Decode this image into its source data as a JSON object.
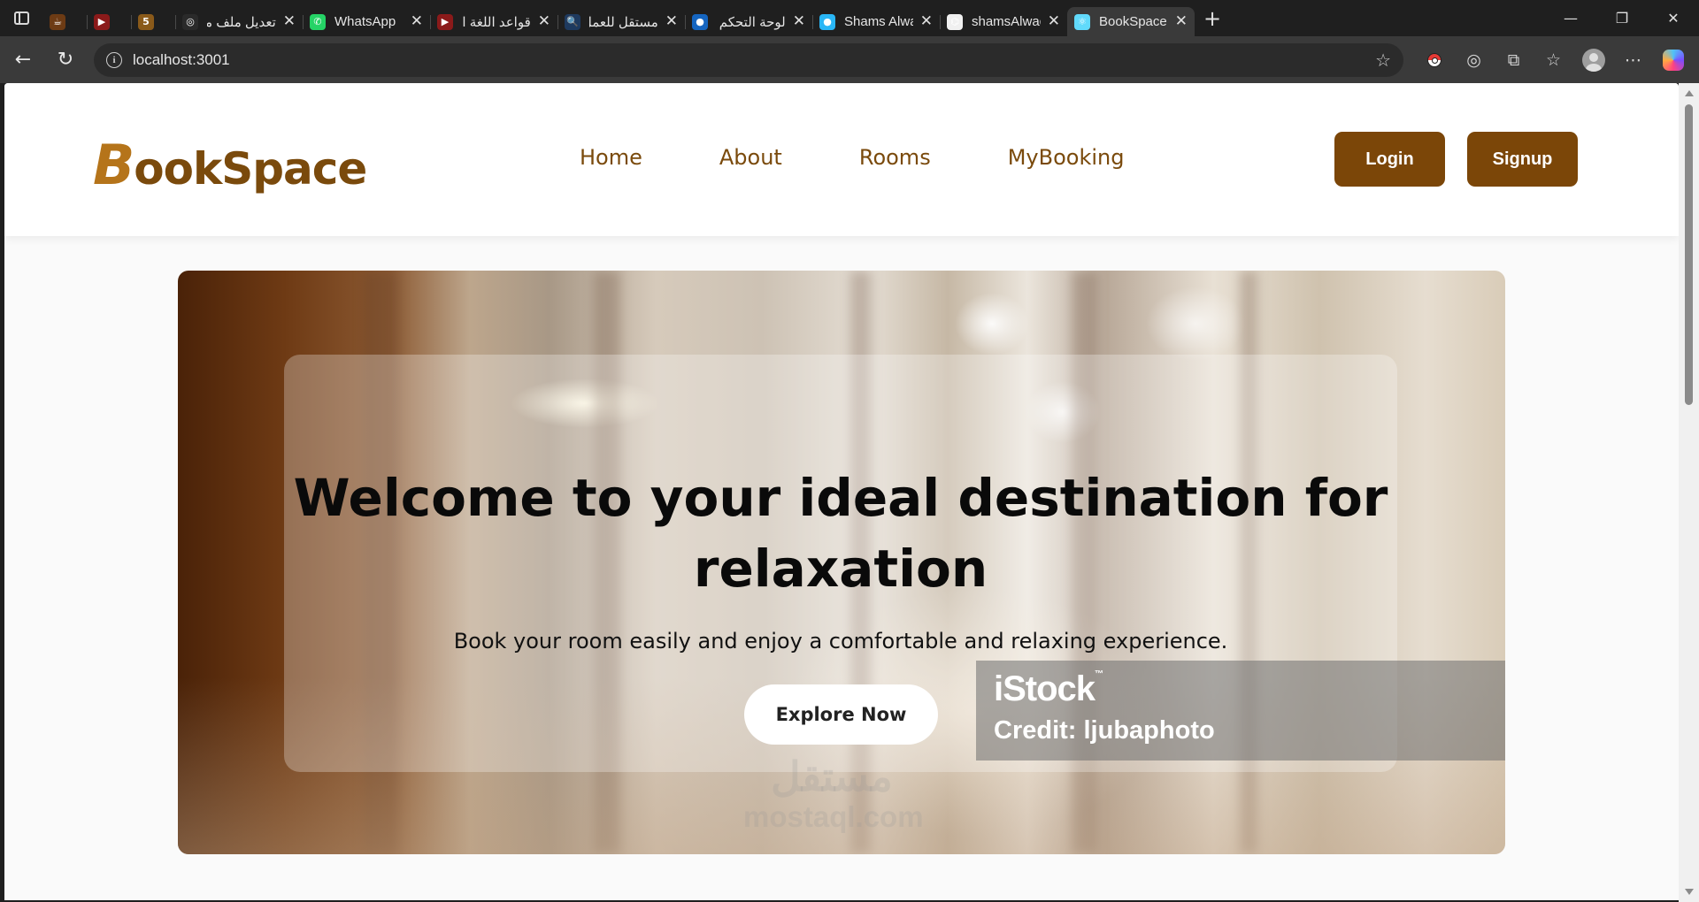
{
  "browser": {
    "tabs": [
      {
        "title": "",
        "fav_color": "#6d3b14",
        "fav_glyph": "☕",
        "active": false,
        "closable": false
      },
      {
        "title": "",
        "fav_color": "#8b1a1a",
        "fav_glyph": "▶",
        "active": false,
        "closable": false
      },
      {
        "title": "",
        "fav_color": "#8a5a1a",
        "fav_glyph": "5",
        "active": false,
        "closable": false
      },
      {
        "title": "تعديل ملف مستـ",
        "fav_color": "#2a2a2a",
        "fav_glyph": "◎",
        "active": false,
        "closable": true
      },
      {
        "title": "WhatsApp",
        "fav_color": "#25d366",
        "fav_glyph": "✆",
        "active": false,
        "closable": true
      },
      {
        "title": "قواعد اللغة الانجـ",
        "fav_color": "#8b1a1a",
        "fav_glyph": "▶",
        "active": false,
        "closable": true
      },
      {
        "title": "مستقل للعمل الـ",
        "fav_color": "#1e3a5f",
        "fav_glyph": "🔍",
        "active": false,
        "closable": true
      },
      {
        "title": "لوحة التحكم | مـ",
        "fav_color": "#1565c0",
        "fav_glyph": "●",
        "active": false,
        "closable": true
      },
      {
        "title": "Shams Alwadiy",
        "fav_color": "#29b6f6",
        "fav_glyph": "●",
        "active": false,
        "closable": true
      },
      {
        "title": "shamsAlwadiya",
        "fav_color": "#f0f0f0",
        "fav_glyph": "⌬",
        "active": false,
        "closable": true
      },
      {
        "title": "BookSpace",
        "fav_color": "#61dafb",
        "fav_glyph": "⚛",
        "active": true,
        "closable": true
      }
    ],
    "url": "localhost:3001"
  },
  "site": {
    "logo_first": "B",
    "logo_rest": "ookSpace",
    "nav": [
      "Home",
      "About",
      "Rooms",
      "MyBooking"
    ],
    "login_label": "Login",
    "signup_label": "Signup",
    "brand_color": "#7b4608"
  },
  "hero": {
    "title": "Welcome to your ideal destination for relaxation",
    "subtitle": "Book your room easily and enjoy a comfortable and relaxing experience.",
    "cta_label": "Explore Now",
    "stock_brand": "iStock",
    "stock_credit": "Credit: ljubaphoto"
  },
  "watermark": {
    "arabic": "مستقل",
    "latin": "mostaql.com"
  }
}
